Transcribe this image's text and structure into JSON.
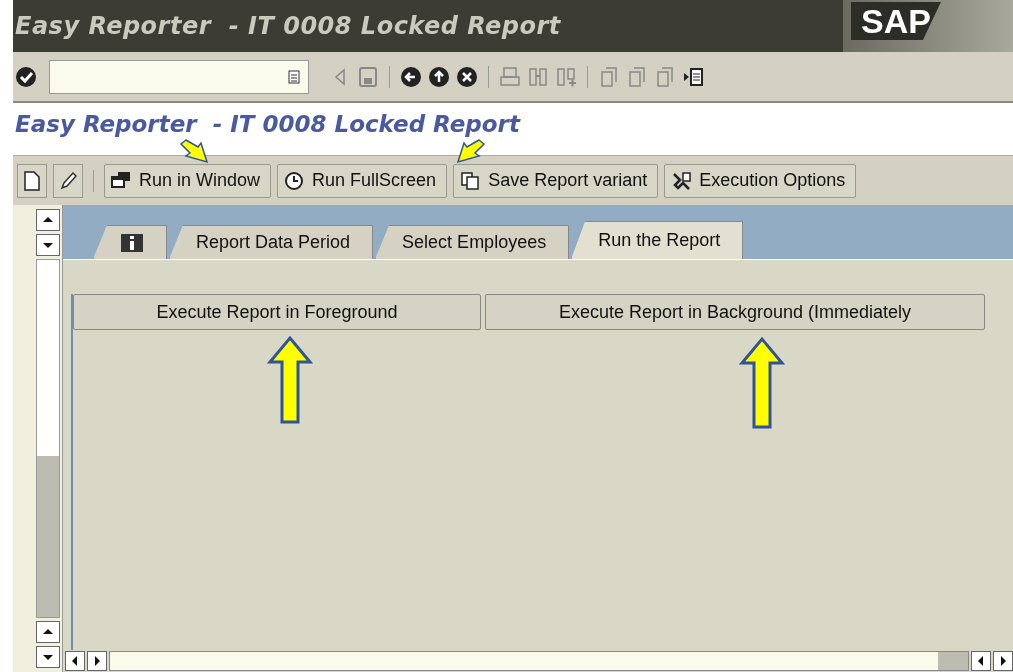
{
  "window": {
    "title": "Easy Reporter  - IT 0008 Locked Report",
    "logo": "SAP"
  },
  "screen_title": "Easy Reporter  - IT 0008 Locked Report",
  "app_toolbar": [
    {
      "label": "Run in Window"
    },
    {
      "label": "Run FullScreen"
    },
    {
      "label": "Save Report variant"
    },
    {
      "label": "Execution Options"
    }
  ],
  "tabs": [
    {
      "kind": "icon",
      "selected": false
    },
    {
      "kind": "text",
      "label": "Report Data Period",
      "selected": false
    },
    {
      "kind": "text",
      "label": "Select Employees",
      "selected": false
    },
    {
      "kind": "text",
      "label": "Run the Report",
      "selected": true
    }
  ],
  "actions": [
    "Execute Report in Foreground",
    "Execute Report in Background (Immediately"
  ]
}
